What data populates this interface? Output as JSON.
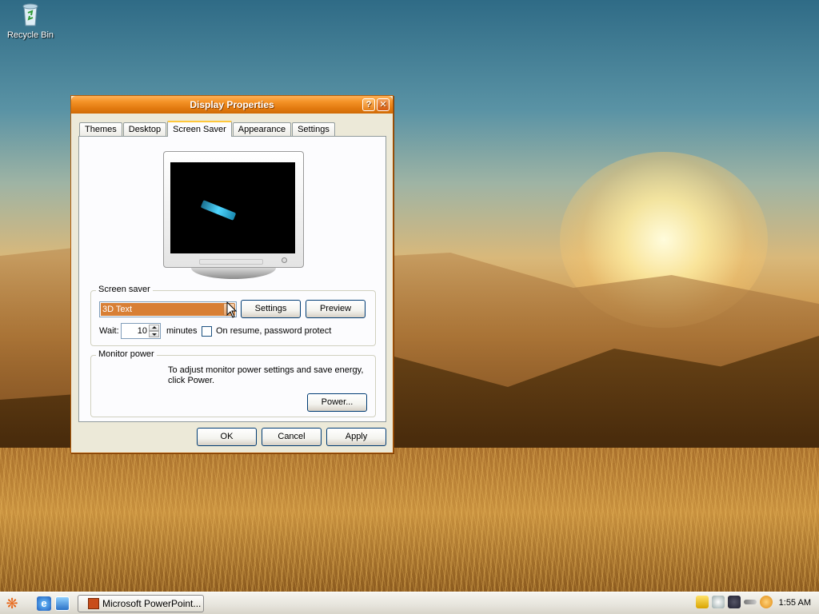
{
  "desktop": {
    "icons": [
      {
        "label": "Recycle Bin",
        "icon": "recycle-bin-icon"
      }
    ]
  },
  "dialog": {
    "title": "Display Properties",
    "title_buttons": {
      "help": "?",
      "close": "✕"
    },
    "tabs": [
      {
        "label": "Themes",
        "active": false
      },
      {
        "label": "Desktop",
        "active": false
      },
      {
        "label": "Screen Saver",
        "active": true
      },
      {
        "label": "Appearance",
        "active": false
      },
      {
        "label": "Settings",
        "active": false
      }
    ],
    "screen_saver": {
      "group_label": "Screen saver",
      "selected": "3D Text",
      "settings_button": "Settings",
      "preview_button": "Preview",
      "wait_label": "Wait:",
      "wait_value": "10",
      "minutes_label": "minutes",
      "password_checkbox_label": "On resume, password protect",
      "password_checked": false
    },
    "monitor_power": {
      "group_label": "Monitor power",
      "description": "To adjust monitor power settings and save energy, click Power.",
      "power_button": "Power..."
    },
    "footer": {
      "ok": "OK",
      "cancel": "Cancel",
      "apply": "Apply"
    }
  },
  "taskbar": {
    "start_icon": "start-menu-icon",
    "quick_launch": [
      "internet-explorer-icon",
      "show-desktop-icon"
    ],
    "tasks": [
      {
        "label": "Microsoft PowerPoint...",
        "icon": "powerpoint-icon"
      }
    ],
    "tray_icons": [
      "security-shield-icon",
      "network-icon",
      "volume-icon",
      "usb-icon",
      "search-icon"
    ],
    "clock": "1:55 AM"
  },
  "colors": {
    "title_bar": "#e27a10",
    "selection": "#d87f35",
    "dialog_bg": "#ece9d8"
  }
}
